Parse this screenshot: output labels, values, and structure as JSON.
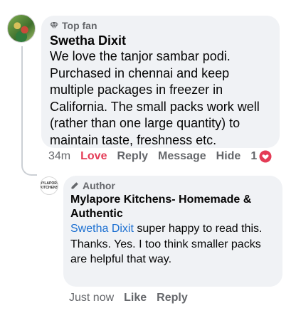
{
  "comment": {
    "badge": "Top fan",
    "author": "Swetha Dixit",
    "text": "We love the tanjor sambar podi. Purchased in chennai and keep multiple packages in freezer in California.  The small packs work well (rather than one large quantity) to maintain taste, freshness etc.",
    "actions": {
      "time": "34m",
      "reaction": "Love",
      "reply": "Reply",
      "message": "Message",
      "hide": "Hide",
      "reaction_count": "1"
    },
    "icons": {
      "badge": "diamond-icon",
      "reaction": "heart-icon"
    }
  },
  "reply": {
    "badge": "Author",
    "author": "Mylapore Kitchens- Homemade & Authentic",
    "mention": "Swetha Dixit",
    "text": " super happy to read this. Thanks. Yes. I too think smaller packs are helpful that way.",
    "avatar_text": "MYLAPORE KITCHENS",
    "actions": {
      "time": "Just now",
      "like": "Like",
      "reply": "Reply"
    },
    "icons": {
      "badge": "pencil-icon"
    }
  },
  "colors": {
    "love": "#e43b56",
    "mention": "#1b6fd1",
    "bubble": "#f0f2f5",
    "meta": "#65676b"
  }
}
